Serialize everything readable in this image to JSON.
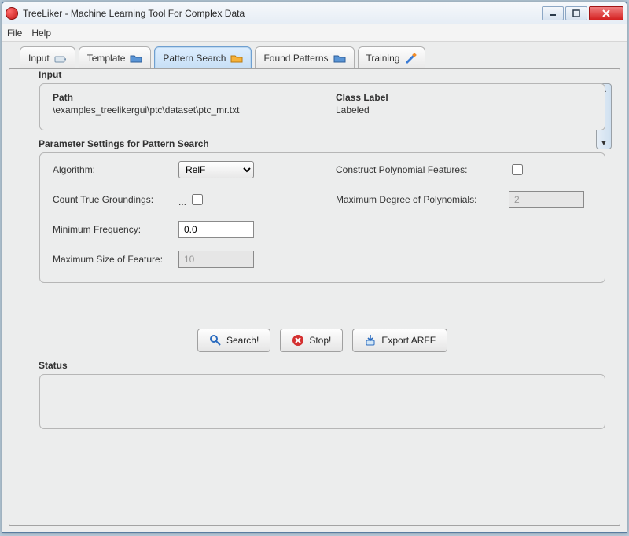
{
  "window": {
    "title": "TreeLiker - Machine Learning Tool For Complex Data"
  },
  "menubar": {
    "file": "File",
    "help": "Help"
  },
  "tabs": {
    "input": "Input",
    "template": "Template",
    "pattern_search": "Pattern Search",
    "found_patterns": "Found Patterns",
    "training": "Training"
  },
  "input_section": {
    "legend": "Input",
    "path_hdr": "Path",
    "path_val": "\\examples_treelikergui\\ptc\\dataset\\ptc_mr.txt",
    "class_hdr": "Class Label",
    "class_val": "Labeled"
  },
  "params": {
    "legend": "Parameter Settings for Pattern Search",
    "algorithm_label": "Algorithm:",
    "algorithm_value": "RelF",
    "count_label": "Count True Groundings:",
    "count_ellipsis": "...",
    "minfreq_label": "Minimum Frequency:",
    "minfreq_value": "0.0",
    "maxsize_label": "Maximum Size of Feature:",
    "maxsize_value": "10",
    "poly_label": "Construct Polynomial Features:",
    "maxdeg_label": "Maximum Degree of Polynomials:",
    "maxdeg_value": "2"
  },
  "buttons": {
    "search": "Search!",
    "stop": "Stop!",
    "export": "Export ARFF"
  },
  "status": {
    "legend": "Status"
  }
}
